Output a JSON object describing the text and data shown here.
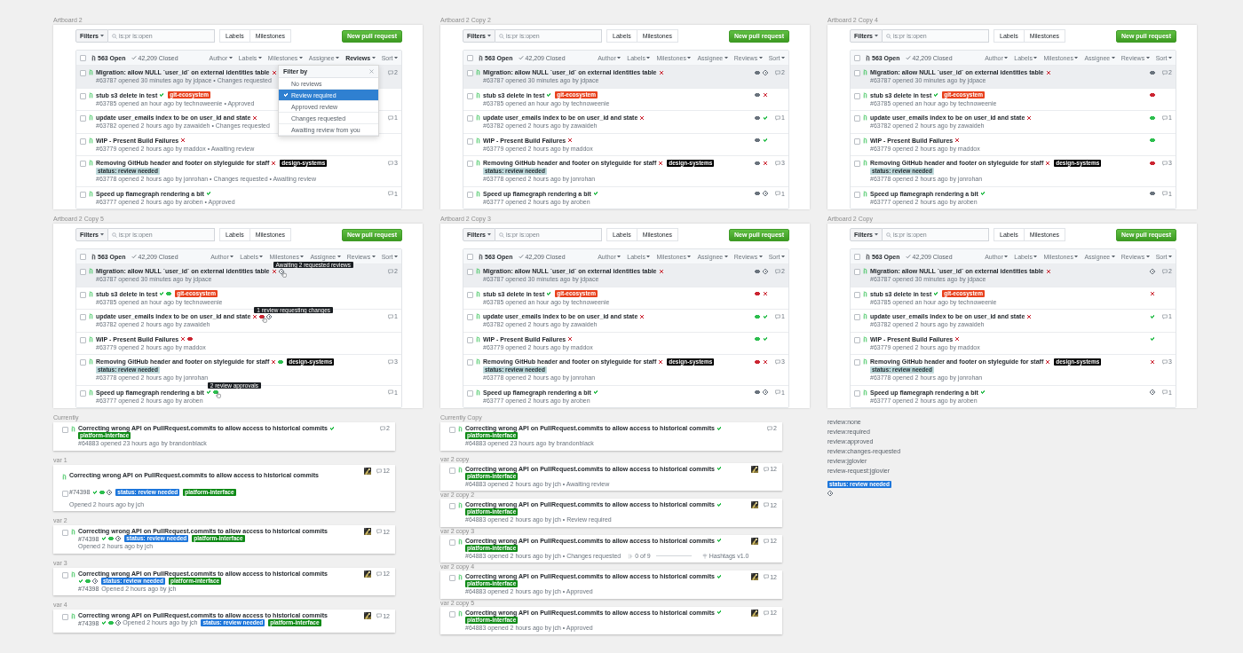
{
  "columns": [
    {
      "sections": [
        {
          "kind": "artboard",
          "label": "Artboard 2",
          "toolbar": {
            "filters": "Filters",
            "search_placeholder": "is:pr is:open",
            "tabs": [
              "Labels",
              "Milestones"
            ],
            "new_button": "New pull request"
          },
          "header": {
            "select_all_checked": false,
            "open": "563 Open",
            "closed": "42,209 Closed",
            "filters": [
              {
                "label": "Author",
                "open": false
              },
              {
                "label": "Labels",
                "open": false
              },
              {
                "label": "Milestones",
                "open": false
              },
              {
                "label": "Assignee",
                "open": false
              },
              {
                "label": "Reviews",
                "open": true
              },
              {
                "label": "Sort",
                "open": false
              }
            ]
          },
          "menu": {
            "title": "Filter by",
            "items": [
              {
                "label": "No reviews",
                "selected": false
              },
              {
                "label": "Review required",
                "selected": true
              },
              {
                "label": "Approved review",
                "selected": false
              },
              {
                "label": "Changes requested",
                "selected": false
              },
              {
                "label": "Awaiting review from you",
                "selected": false
              }
            ]
          },
          "rows": [
            {
              "title": "Migration: allow NULL `user_id` on external identities table",
              "checks_passed": false,
              "meta": "#63787 opened 30 minutes ago by jdpace • Changes requested",
              "comments": "2",
              "highlighted": true
            },
            {
              "title": "stub s3 delete in test",
              "checks_passed": true,
              "tags": [
                {
                  "text": "git-ecosystem",
                  "color": "#e8401c"
                }
              ],
              "meta": "#63785 opened an hour ago by technoweenie • Approved",
              "highlighted": false
            },
            {
              "title": "update user_emails index to be on user_id and state",
              "checks_passed": false,
              "meta": "#63782 opened 2 hours ago by zawaideh • Changes requested",
              "comments": "1",
              "highlighted": false
            },
            {
              "title": "WIP - Present Build Failures",
              "checks_passed": false,
              "meta": "#63779 opened 2 hours ago by maddox • Awaiting review",
              "highlighted": false
            },
            {
              "title": "Removing GitHub header and footer on styleguide for staff",
              "checks_passed": false,
              "tags": [
                {
                  "text": "design-systems",
                  "color": "#000000"
                }
              ],
              "sublabels": [
                {
                  "text": "status: review needed",
                  "color": "#bfdadc"
                }
              ],
              "meta": "#63778 opened 2 hours ago by jonrohan • Changes requested • Awaiting review",
              "comments": "3",
              "highlighted": false
            },
            {
              "title": "Speed up flamegraph rendering a bit",
              "checks_passed": true,
              "meta": "#63777 opened 2 hours ago by aroben • Approved",
              "comments": "1",
              "highlighted": false
            }
          ]
        },
        {
          "kind": "artboard",
          "label": "Artboard 2 Copy 5",
          "toolbar": {
            "filters": "Filters",
            "search_placeholder": "is:pr is:open",
            "tabs": [
              "Labels",
              "Milestones"
            ],
            "new_button": "New pull request"
          },
          "header": {
            "select_all_checked": false,
            "open": "563 Open",
            "closed": "42,209 Closed",
            "filters": [
              {
                "label": "Author",
                "open": false
              },
              {
                "label": "Labels",
                "open": false
              },
              {
                "label": "Milestones",
                "open": false
              },
              {
                "label": "Assignee",
                "open": false
              },
              {
                "label": "Reviews",
                "open": false
              },
              {
                "label": "Sort",
                "open": false
              }
            ]
          },
          "rows": [
            {
              "title": "Migration: allow NULL `user_id` on external identities table",
              "checks_passed": false,
              "inline_icons": [
                {
                  "kind": "clock",
                  "color": "#6a737d",
                  "tooltip": "Awaiting 2 requested reviews"
                }
              ],
              "meta": "#63787 opened 30 minutes ago by jdpace",
              "comments": "2",
              "highlighted": true
            },
            {
              "title": "stub s3 delete in test",
              "checks_passed": true,
              "inline_icons": [
                {
                  "kind": "eye",
                  "color": "#2cbe4e"
                }
              ],
              "tags": [
                {
                  "text": "git-ecosystem",
                  "color": "#e8401c"
                }
              ],
              "meta": "#63785 opened an hour ago by technoweenie",
              "highlighted": false
            },
            {
              "title": "update user_emails index to be on user_id and state",
              "checks_passed": false,
              "inline_icons": [
                {
                  "kind": "eye",
                  "color": "#cb2431",
                  "tooltip": "1 review requesting changes"
                },
                {
                  "kind": "clock",
                  "color": "#6a737d"
                }
              ],
              "meta": "#63782 opened 2 hours ago by zawaideh",
              "comments": "1",
              "highlighted": false
            },
            {
              "title": "WIP - Present Build Failures",
              "checks_passed": false,
              "inline_icons": [
                {
                  "kind": "eye",
                  "color": "#cb2431"
                }
              ],
              "meta": "#63779 opened 2 hours ago by maddox",
              "highlighted": false
            },
            {
              "title": "Removing GitHub header and footer on styleguide for staff",
              "checks_passed": false,
              "inline_icons": [
                {
                  "kind": "eye",
                  "color": "#2cbe4e"
                }
              ],
              "tags": [
                {
                  "text": "design-systems",
                  "color": "#000000"
                }
              ],
              "sublabels": [
                {
                  "text": "status: review needed",
                  "color": "#bfdadc"
                }
              ],
              "meta": "#63778 opened 2 hours ago by jonrohan",
              "comments": "3",
              "highlighted": false
            },
            {
              "title": "Speed up flamegraph rendering a bit",
              "checks_passed": true,
              "inline_icons": [
                {
                  "kind": "eye",
                  "color": "#2cbe4e",
                  "tooltip": "2 review approvals"
                }
              ],
              "meta": "#63777 opened 2 hours ago by aroben",
              "comments": "1",
              "highlighted": false
            }
          ]
        },
        {
          "kind": "variant",
          "label": "Currently",
          "card": {
            "kind": "stacked",
            "title": "Correcting wrong API on PullRequest.commits to allow access to historical commits",
            "checks_passed": true,
            "tags": [
              {
                "text": "platform-interface",
                "color": "#0e8a16"
              }
            ],
            "meta": "#64883 opened 23 hours ago by brandonblack",
            "comments": "2",
            "avatar": false
          }
        },
        {
          "kind": "variant",
          "label": "var 1",
          "card": {
            "kind": "offset",
            "title": "Correcting wrong API on PullRequest.commits to allow access to historical commits",
            "number": "#74398",
            "icons": [
              {
                "kind": "check",
                "color": "#2cbe4e"
              },
              {
                "kind": "eye",
                "color": "#2cbe4e"
              },
              {
                "kind": "clock",
                "color": "#6a737d"
              }
            ],
            "tags": [
              {
                "text": "status: review needed",
                "color": "#1d76db"
              },
              {
                "text": "platform-interface",
                "color": "#0e8a16"
              }
            ],
            "meta": "Opened 2 hours ago by jch",
            "comments": "12",
            "avatar": true
          }
        },
        {
          "kind": "variant",
          "label": "var 2",
          "card": {
            "kind": "numbered",
            "title": "Correcting wrong API on PullRequest.commits to allow access to historical commits",
            "number": "#74398",
            "icons": [
              {
                "kind": "check",
                "color": "#2cbe4e"
              },
              {
                "kind": "eye",
                "color": "#2cbe4e"
              },
              {
                "kind": "clock",
                "color": "#6a737d"
              }
            ],
            "tags": [
              {
                "text": "status: review needed",
                "color": "#1d76db"
              },
              {
                "text": "platform-interface",
                "color": "#0e8a16"
              }
            ],
            "meta": "Opened 2 hours ago by jch",
            "comments": "12",
            "avatar": true
          }
        },
        {
          "kind": "variant",
          "label": "var 3",
          "card": {
            "kind": "trailing",
            "title": "Correcting wrong API on PullRequest.commits to allow access to historical commits",
            "number": "#74398",
            "icons": [
              {
                "kind": "check",
                "color": "#2cbe4e"
              },
              {
                "kind": "eye",
                "color": "#2cbe4e"
              },
              {
                "kind": "clock",
                "color": "#6a737d"
              }
            ],
            "tags": [
              {
                "text": "status: review needed",
                "color": "#1d76db"
              },
              {
                "text": "platform-interface",
                "color": "#0e8a16"
              }
            ],
            "meta": "Opened 2 hours ago by jch",
            "comments": "12",
            "avatar": true
          }
        },
        {
          "kind": "variant",
          "label": "var 4",
          "card": {
            "kind": "compact",
            "title": "Correcting wrong API on PullRequest.commits to allow access to historical commits",
            "number": "#74398",
            "icons": [
              {
                "kind": "check",
                "color": "#2cbe4e"
              },
              {
                "kind": "eye",
                "color": "#2cbe4e"
              },
              {
                "kind": "clock",
                "color": "#6a737d"
              }
            ],
            "tags": [
              {
                "text": "status: review needed",
                "color": "#1d76db"
              },
              {
                "text": "platform-interface",
                "color": "#0e8a16"
              }
            ],
            "meta": "Opened 2 hours ago by jch",
            "comments": "12",
            "avatar": true
          }
        }
      ]
    },
    {
      "sections": [
        {
          "kind": "artboard",
          "label": "Artboard 2 Copy 2",
          "toolbar": {
            "filters": "Filters",
            "search_placeholder": "is:pr is:open",
            "tabs": [
              "Labels",
              "Milestones"
            ],
            "new_button": "New pull request"
          },
          "header": {
            "select_all_checked": false,
            "open": "563 Open",
            "closed": "42,209 Closed",
            "filters": [
              {
                "label": "Author",
                "open": false
              },
              {
                "label": "Labels",
                "open": false
              },
              {
                "label": "Milestones",
                "open": false
              },
              {
                "label": "Assignee",
                "open": false
              },
              {
                "label": "Reviews",
                "open": false
              },
              {
                "label": "Sort",
                "open": false
              }
            ]
          },
          "rows": [
            {
              "title": "Migration: allow NULL `user_id` on external identities table",
              "checks_passed": false,
              "right_icons": [
                {
                  "kind": "eye",
                  "color": "#6a737d"
                },
                {
                  "kind": "clock",
                  "color": "#6a737d"
                }
              ],
              "meta": "#63787 opened 30 minutes ago by jdpace",
              "comments": "2",
              "highlighted": true
            },
            {
              "title": "stub s3 delete in test",
              "checks_passed": true,
              "tags": [
                {
                  "text": "git-ecosystem",
                  "color": "#e8401c"
                }
              ],
              "right_icons": [
                {
                  "kind": "eye",
                  "color": "#6a737d"
                },
                {
                  "kind": "cross",
                  "color": "#cb2431"
                }
              ],
              "meta": "#63785 opened an hour ago by technoweenie",
              "highlighted": false
            },
            {
              "title": "update user_emails index to be on user_id and state",
              "checks_passed": false,
              "right_icons": [
                {
                  "kind": "eye",
                  "color": "#6a737d"
                },
                {
                  "kind": "check",
                  "color": "#2cbe4e"
                }
              ],
              "meta": "#63782 opened 2 hours ago by zawaideh",
              "comments": "1",
              "highlighted": false
            },
            {
              "title": "WIP - Present Build Failures",
              "checks_passed": false,
              "right_icons": [
                {
                  "kind": "eye",
                  "color": "#6a737d"
                },
                {
                  "kind": "check",
                  "color": "#2cbe4e"
                }
              ],
              "meta": "#63779 opened 2 hours ago by maddox",
              "highlighted": false
            },
            {
              "title": "Removing GitHub header and footer on styleguide for staff",
              "checks_passed": false,
              "tags": [
                {
                  "text": "design-systems",
                  "color": "#000000"
                }
              ],
              "sublabels": [
                {
                  "text": "status: review needed",
                  "color": "#bfdadc"
                }
              ],
              "right_icons": [
                {
                  "kind": "eye",
                  "color": "#6a737d"
                },
                {
                  "kind": "cross",
                  "color": "#cb2431"
                }
              ],
              "meta": "#63778 opened 2 hours ago by jonrohan",
              "comments": "3",
              "highlighted": false
            },
            {
              "title": "Speed up flamegraph rendering a bit",
              "checks_passed": true,
              "right_icons": [
                {
                  "kind": "eye",
                  "color": "#6a737d"
                },
                {
                  "kind": "clock",
                  "color": "#6a737d"
                }
              ],
              "meta": "#63777 opened 2 hours ago by aroben",
              "comments": "1",
              "highlighted": false
            }
          ]
        },
        {
          "kind": "artboard",
          "label": "Artboard 2 Copy 3",
          "toolbar": {
            "filters": "Filters",
            "search_placeholder": "is:pr is:open",
            "tabs": [
              "Labels",
              "Milestones"
            ],
            "new_button": "New pull request"
          },
          "header": {
            "select_all_checked": false,
            "open": "563 Open",
            "closed": "42,209 Closed",
            "filters": [
              {
                "label": "Author",
                "open": false
              },
              {
                "label": "Labels",
                "open": false
              },
              {
                "label": "Milestones",
                "open": false
              },
              {
                "label": "Assignee",
                "open": false
              },
              {
                "label": "Reviews",
                "open": false
              },
              {
                "label": "Sort",
                "open": false
              }
            ]
          },
          "rows": [
            {
              "title": "Migration: allow NULL `user_id` on external identities table",
              "checks_passed": false,
              "right_icons": [
                {
                  "kind": "eye",
                  "color": "#6a737d"
                },
                {
                  "kind": "clock",
                  "color": "#6a737d"
                }
              ],
              "meta": "#63787 opened 30 minutes ago by jdpace",
              "comments": "2",
              "highlighted": true
            },
            {
              "title": "stub s3 delete in test",
              "checks_passed": true,
              "tags": [
                {
                  "text": "git-ecosystem",
                  "color": "#e8401c"
                }
              ],
              "right_icons": [
                {
                  "kind": "eye",
                  "color": "#cb2431"
                },
                {
                  "kind": "cross",
                  "color": "#cb2431"
                }
              ],
              "meta": "#63785 opened an hour ago by technoweenie",
              "highlighted": false
            },
            {
              "title": "update user_emails index to be on user_id and state",
              "checks_passed": false,
              "right_icons": [
                {
                  "kind": "eye",
                  "color": "#2cbe4e"
                },
                {
                  "kind": "check",
                  "color": "#2cbe4e"
                }
              ],
              "meta": "#63782 opened 2 hours ago by zawaideh",
              "comments": "1",
              "highlighted": false
            },
            {
              "title": "WIP - Present Build Failures",
              "checks_passed": false,
              "right_icons": [
                {
                  "kind": "eye",
                  "color": "#2cbe4e"
                },
                {
                  "kind": "check",
                  "color": "#2cbe4e"
                }
              ],
              "meta": "#63779 opened 2 hours ago by maddox",
              "highlighted": false
            },
            {
              "title": "Removing GitHub header and footer on styleguide for staff",
              "checks_passed": false,
              "tags": [
                {
                  "text": "design-systems",
                  "color": "#000000"
                }
              ],
              "sublabels": [
                {
                  "text": "status: review needed",
                  "color": "#bfdadc"
                }
              ],
              "right_icons": [
                {
                  "kind": "eye",
                  "color": "#cb2431"
                },
                {
                  "kind": "cross",
                  "color": "#cb2431"
                }
              ],
              "meta": "#63778 opened 2 hours ago by jonrohan",
              "comments": "3",
              "highlighted": false
            },
            {
              "title": "Speed up flamegraph rendering a bit",
              "checks_passed": true,
              "right_icons": [
                {
                  "kind": "eye",
                  "color": "#6a737d"
                },
                {
                  "kind": "clock",
                  "color": "#6a737d"
                }
              ],
              "meta": "#63777 opened 2 hours ago by aroben",
              "comments": "1",
              "highlighted": false
            }
          ]
        },
        {
          "kind": "variant",
          "label": "Currently Copy",
          "card": {
            "kind": "stacked",
            "title": "Correcting wrong API on PullRequest.commits to allow access to historical commits",
            "checks_passed": true,
            "tags": [
              {
                "text": "platform-interface",
                "color": "#0e8a16"
              }
            ],
            "meta": "#64883 opened 23 hours ago by brandonblack",
            "comments": "2",
            "avatar": false
          }
        },
        {
          "kind": "variant",
          "label": "var 2 copy",
          "card": {
            "kind": "stacked",
            "title": "Correcting wrong API on PullRequest.commits to allow access to historical commits",
            "checks_passed": true,
            "tags": [
              {
                "text": "platform-interface",
                "color": "#0e8a16"
              }
            ],
            "meta": "#64883 opened 2 hours ago by jch • Awaiting review",
            "comments": "12",
            "avatar": true
          }
        },
        {
          "kind": "variant",
          "label": "var 2 copy 2",
          "card": {
            "kind": "stacked",
            "title": "Correcting wrong API on PullRequest.commits to allow access to historical commits",
            "checks_passed": true,
            "tags": [
              {
                "text": "platform-interface",
                "color": "#0e8a16"
              }
            ],
            "meta": "#64883 opened 2 hours ago by jch • Review required",
            "comments": "12",
            "avatar": true
          }
        },
        {
          "kind": "variant",
          "label": "var 2 copy 3",
          "card": {
            "kind": "stacked",
            "title": "Correcting wrong API on PullRequest.commits to allow access to historical commits",
            "checks_passed": true,
            "tags": [
              {
                "text": "platform-interface",
                "color": "#0e8a16"
              }
            ],
            "meta": "#64883 opened 2 hours ago by jch • Changes requested",
            "progress": {
              "text": "0 of 9",
              "level": 0
            },
            "milestone": "Hashtags v1.0",
            "comments": "12",
            "avatar": true
          }
        },
        {
          "kind": "variant",
          "label": "var 2 copy 4",
          "card": {
            "kind": "stacked",
            "title": "Correcting wrong API on PullRequest.commits to allow access to historical commits",
            "checks_passed": true,
            "tags": [
              {
                "text": "platform-interface",
                "color": "#0e8a16"
              }
            ],
            "meta": "#64883 opened 2 hours ago by jch • Approved",
            "comments": "12",
            "avatar": true
          }
        },
        {
          "kind": "variant",
          "label": "var 2 copy 5",
          "card": {
            "kind": "stacked",
            "title": "Correcting wrong API on PullRequest.commits to allow access to historical commits",
            "checks_passed": true,
            "tags": [
              {
                "text": "platform-interface",
                "color": "#0e8a16"
              }
            ],
            "meta": "#64883 opened 2 hours ago by jch • Approved",
            "comments": "12",
            "avatar": true
          }
        }
      ]
    },
    {
      "sections": [
        {
          "kind": "artboard",
          "label": "Artboard 2 Copy 4",
          "toolbar": {
            "filters": "Filters",
            "search_placeholder": "is:pr is:open",
            "tabs": [
              "Labels",
              "Milestones"
            ],
            "new_button": "New pull request"
          },
          "header": {
            "select_all_checked": false,
            "open": "563 Open",
            "closed": "42,209 Closed",
            "filters": [
              {
                "label": "Author",
                "open": false
              },
              {
                "label": "Labels",
                "open": false
              },
              {
                "label": "Milestones",
                "open": false
              },
              {
                "label": "Assignee",
                "open": false
              },
              {
                "label": "Reviews",
                "open": false
              },
              {
                "label": "Sort",
                "open": false
              }
            ]
          },
          "rows": [
            {
              "title": "Migration: allow NULL `user_id` on external identities table",
              "checks_passed": false,
              "right_icons": [
                {
                  "kind": "eye",
                  "color": "#6a737d"
                }
              ],
              "meta": "#63787 opened 30 minutes ago by jdpace",
              "comments": "2",
              "highlighted": true
            },
            {
              "title": "stub s3 delete in test",
              "checks_passed": true,
              "tags": [
                {
                  "text": "git-ecosystem",
                  "color": "#e8401c"
                }
              ],
              "right_icons": [
                {
                  "kind": "eye",
                  "color": "#cb2431"
                }
              ],
              "meta": "#63785 opened an hour ago by technoweenie",
              "highlighted": false
            },
            {
              "title": "update user_emails index to be on user_id and state",
              "checks_passed": false,
              "right_icons": [
                {
                  "kind": "eye",
                  "color": "#2cbe4e"
                }
              ],
              "meta": "#63782 opened 2 hours ago by zawaideh",
              "comments": "1",
              "highlighted": false
            },
            {
              "title": "WIP - Present Build Failures",
              "checks_passed": false,
              "right_icons": [
                {
                  "kind": "eye",
                  "color": "#2cbe4e"
                }
              ],
              "meta": "#63779 opened 2 hours ago by maddox",
              "highlighted": false
            },
            {
              "title": "Removing GitHub header and footer on styleguide for staff",
              "checks_passed": false,
              "tags": [
                {
                  "text": "design-systems",
                  "color": "#000000"
                }
              ],
              "sublabels": [
                {
                  "text": "status: review needed",
                  "color": "#bfdadc"
                }
              ],
              "right_icons": [
                {
                  "kind": "eye",
                  "color": "#cb2431"
                }
              ],
              "meta": "#63778 opened 2 hours ago by jonrohan",
              "comments": "3",
              "highlighted": false
            },
            {
              "title": "Speed up flamegraph rendering a bit",
              "checks_passed": true,
              "right_icons": [
                {
                  "kind": "eye",
                  "color": "#6a737d"
                }
              ],
              "meta": "#63777 opened 2 hours ago by aroben",
              "comments": "1",
              "highlighted": false
            }
          ]
        },
        {
          "kind": "artboard",
          "label": "Artboard 2 Copy",
          "toolbar": {
            "filters": "Filters",
            "search_placeholder": "is:pr is:open",
            "tabs": [
              "Labels",
              "Milestones"
            ],
            "new_button": "New pull request"
          },
          "header": {
            "select_all_checked": false,
            "open": "563 Open",
            "closed": "42,209 Closed",
            "filters": [
              {
                "label": "Author",
                "open": false
              },
              {
                "label": "Labels",
                "open": false
              },
              {
                "label": "Milestones",
                "open": false
              },
              {
                "label": "Assignee",
                "open": false
              },
              {
                "label": "Reviews",
                "open": false
              },
              {
                "label": "Sort",
                "open": false
              }
            ]
          },
          "rows": [
            {
              "title": "Migration: allow NULL `user_id` on external identities table",
              "checks_passed": false,
              "right_icons": [
                {
                  "kind": "clock",
                  "color": "#6a737d"
                }
              ],
              "meta": "#63787 opened 30 minutes ago by jdpace",
              "comments": "2",
              "highlighted": true
            },
            {
              "title": "stub s3 delete in test",
              "checks_passed": true,
              "tags": [
                {
                  "text": "git-ecosystem",
                  "color": "#e8401c"
                }
              ],
              "right_icons": [
                {
                  "kind": "cross",
                  "color": "#cb2431"
                }
              ],
              "meta": "#63785 opened an hour ago by technoweenie",
              "highlighted": false
            },
            {
              "title": "update user_emails index to be on user_id and state",
              "checks_passed": false,
              "right_icons": [
                {
                  "kind": "check",
                  "color": "#2cbe4e"
                }
              ],
              "meta": "#63782 opened 2 hours ago by zawaideh",
              "comments": "1",
              "highlighted": false
            },
            {
              "title": "WIP - Present Build Failures",
              "checks_passed": false,
              "right_icons": [
                {
                  "kind": "check",
                  "color": "#2cbe4e"
                }
              ],
              "meta": "#63779 opened 2 hours ago by maddox",
              "highlighted": false
            },
            {
              "title": "Removing GitHub header and footer on styleguide for staff",
              "checks_passed": false,
              "tags": [
                {
                  "text": "design-systems",
                  "color": "#000000"
                }
              ],
              "sublabels": [
                {
                  "text": "status: review needed",
                  "color": "#bfdadc"
                }
              ],
              "right_icons": [
                {
                  "kind": "cross",
                  "color": "#cb2431"
                }
              ],
              "meta": "#63778 opened 2 hours ago by jonrohan",
              "comments": "3",
              "highlighted": false
            },
            {
              "title": "Speed up flamegraph rendering a bit",
              "checks_passed": true,
              "right_icons": [
                {
                  "kind": "clock",
                  "color": "#6a737d"
                }
              ],
              "meta": "#63777 opened 2 hours ago by aroben",
              "comments": "1",
              "highlighted": false
            }
          ]
        },
        {
          "kind": "legend",
          "lines": [
            "review:none",
            "review:required",
            "review:approved",
            "review:changes-requested",
            "review:jglovier",
            "review-request:jglovier"
          ],
          "tag": {
            "text": "status: review needed",
            "color": "#1d76db"
          }
        }
      ]
    }
  ]
}
